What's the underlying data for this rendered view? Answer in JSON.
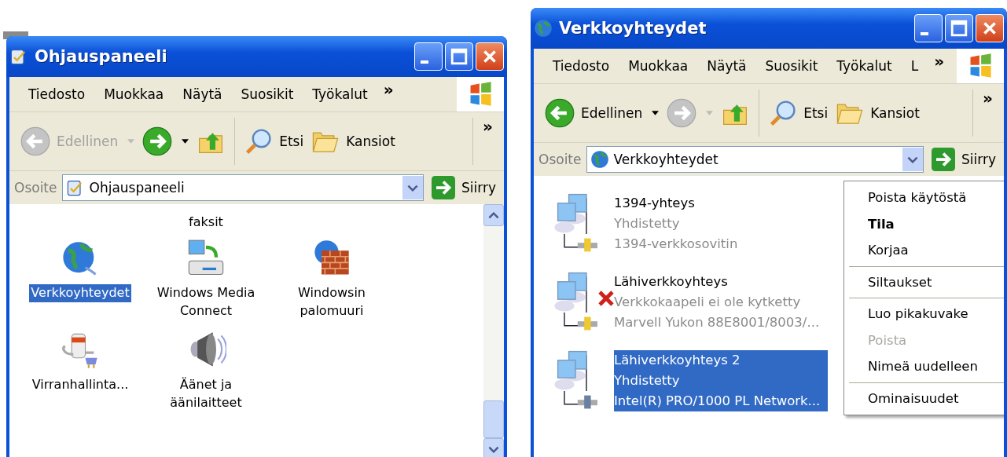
{
  "windows": [
    {
      "title": "Ohjauspaneeli",
      "menu": [
        "Tiedosto",
        "Muokkaa",
        "Näytä",
        "Suosikit",
        "Työkalut"
      ],
      "menu_more": "»",
      "toolbar_more": "»",
      "toolbar": [
        {
          "kind": "back",
          "label": "Edellinen",
          "disabled": true
        },
        {
          "kind": "forward",
          "disabled": false
        },
        {
          "kind": "up",
          "disabled": false
        },
        {
          "kind": "search",
          "label": "Etsi",
          "disabled": false
        },
        {
          "kind": "folders",
          "label": "Kansiot",
          "disabled": false
        }
      ],
      "address_label": "Osoite",
      "address": "Ohjauspaneeli",
      "go": "Siirry",
      "items": [
        {
          "kind": "none",
          "lines": [
            "faksit"
          ],
          "selected": false
        },
        {
          "kind": "globe",
          "lines": [
            "Verkkoyhteydet"
          ],
          "selected": true
        },
        {
          "kind": "media",
          "lines": [
            "Windows Media",
            "Connect"
          ],
          "selected": false
        },
        {
          "kind": "firewall",
          "lines": [
            "Windowsin",
            "palomuuri"
          ],
          "selected": false
        },
        {
          "kind": "power",
          "lines": [
            "Virranhallinta..."
          ],
          "selected": false
        },
        {
          "kind": "speaker",
          "lines": [
            "Äänet ja",
            "äänilaitteet"
          ],
          "selected": false
        }
      ]
    },
    {
      "title": "Verkkoyhteydet",
      "menu": [
        "Tiedosto",
        "Muokkaa",
        "Näytä",
        "Suosikit",
        "Työkalut",
        "L"
      ],
      "menu_more": "»",
      "toolbar_more": "»",
      "toolbar": [
        {
          "kind": "back",
          "label": "Edellinen",
          "disabled": false
        },
        {
          "kind": "forward",
          "disabled": true
        },
        {
          "kind": "up",
          "disabled": false
        },
        {
          "kind": "search",
          "label": "Etsi",
          "disabled": false
        },
        {
          "kind": "folders",
          "label": "Kansiot",
          "disabled": false
        }
      ],
      "address_label": "Osoite",
      "address": "Verkkoyhteydet",
      "go": "Siirry",
      "connections": [
        {
          "name": "1394-yhteys",
          "status": "Yhdistetty",
          "device": "1394-verkkosovitin",
          "cable_unplugged": false,
          "selected": false
        },
        {
          "name": "Lähiverkkoyhteys",
          "status": "Verkkokaapeli ei ole kytketty",
          "device": "Marvell Yukon 88E8001/8003/...",
          "cable_unplugged": true,
          "selected": false
        },
        {
          "name": "Lähiverkkoyhteys 2",
          "status": "Yhdistetty",
          "device": "Intel(R) PRO/1000 PL Network...",
          "cable_unplugged": false,
          "selected": true
        }
      ],
      "context_menu": [
        {
          "kind": "item",
          "label": "Poista käytöstä",
          "default": false,
          "disabled": false
        },
        {
          "kind": "item",
          "label": "Tila",
          "default": true,
          "disabled": false
        },
        {
          "kind": "item",
          "label": "Korjaa",
          "default": false,
          "disabled": false
        },
        {
          "kind": "separator"
        },
        {
          "kind": "item",
          "label": "Siltaukset",
          "default": false,
          "disabled": false
        },
        {
          "kind": "separator"
        },
        {
          "kind": "item",
          "label": "Luo pikakuvake",
          "default": false,
          "disabled": false
        },
        {
          "kind": "item",
          "label": "Poista",
          "default": false,
          "disabled": true
        },
        {
          "kind": "item",
          "label": "Nimeä uudelleen",
          "default": false,
          "disabled": false
        },
        {
          "kind": "separator"
        },
        {
          "kind": "item",
          "label": "Ominaisuudet",
          "default": false,
          "disabled": false
        }
      ]
    }
  ]
}
